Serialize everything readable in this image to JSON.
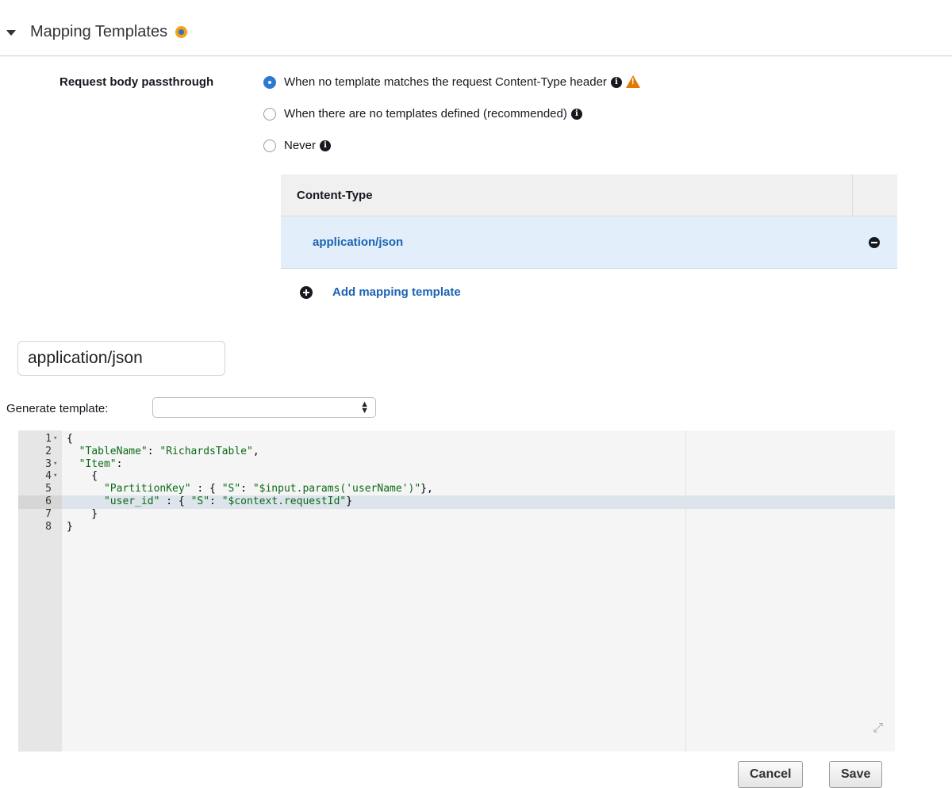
{
  "section": {
    "title": "Mapping Templates"
  },
  "passthrough": {
    "label": "Request body passthrough",
    "options": [
      {
        "label": "When no template matches the request Content-Type header",
        "checked": true
      },
      {
        "label": "When there are no templates defined (recommended)",
        "checked": false
      },
      {
        "label": "Never",
        "checked": false
      }
    ]
  },
  "content_table": {
    "header": "Content-Type",
    "rows": [
      {
        "label": "application/json"
      }
    ],
    "add_label": "Add mapping template"
  },
  "content_type_input": {
    "value": "application/json"
  },
  "generate": {
    "label": "Generate template:",
    "selected": ""
  },
  "editor": {
    "active_line": 6,
    "lines": [
      {
        "num": "1",
        "fold": true,
        "parts": [
          [
            "p",
            "{"
          ]
        ]
      },
      {
        "num": "2",
        "fold": false,
        "parts": [
          [
            "p",
            "  "
          ],
          [
            "s",
            "\"TableName\""
          ],
          [
            "p",
            ": "
          ],
          [
            "s",
            "\"RichardsTable\""
          ],
          [
            "p",
            ","
          ]
        ]
      },
      {
        "num": "3",
        "fold": true,
        "parts": [
          [
            "p",
            "  "
          ],
          [
            "s",
            "\"Item\""
          ],
          [
            "p",
            ":"
          ]
        ]
      },
      {
        "num": "4",
        "fold": true,
        "parts": [
          [
            "p",
            "    {"
          ]
        ]
      },
      {
        "num": "5",
        "fold": false,
        "parts": [
          [
            "p",
            "      "
          ],
          [
            "s",
            "\"PartitionKey\""
          ],
          [
            "p",
            " : { "
          ],
          [
            "s",
            "\"S\""
          ],
          [
            "p",
            ": "
          ],
          [
            "s",
            "\"$input.params('userName')\""
          ],
          [
            "p",
            "},"
          ]
        ]
      },
      {
        "num": "6",
        "fold": false,
        "parts": [
          [
            "p",
            "      "
          ],
          [
            "s",
            "\"user_id\""
          ],
          [
            "p",
            " : { "
          ],
          [
            "s",
            "\"S\""
          ],
          [
            "p",
            ": "
          ],
          [
            "s",
            "\"$context.requestId\""
          ],
          [
            "p",
            "}"
          ]
        ]
      },
      {
        "num": "7",
        "fold": false,
        "parts": [
          [
            "p",
            "    }"
          ]
        ]
      },
      {
        "num": "8",
        "fold": false,
        "parts": [
          [
            "p",
            "}"
          ]
        ]
      }
    ]
  },
  "buttons": {
    "cancel": "Cancel",
    "save": "Save"
  },
  "colors": {
    "link": "#1c63b4",
    "selected_row": "#e2effb",
    "radio_checked": "#2e78d4",
    "warning": "#e07b00",
    "string": "#0a6b16"
  }
}
